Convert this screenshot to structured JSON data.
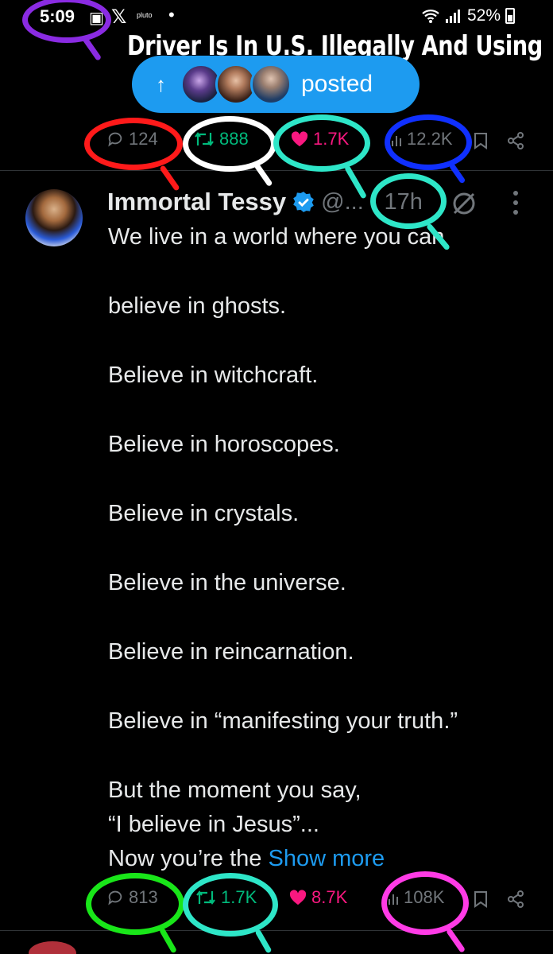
{
  "status_bar": {
    "time": "5:09",
    "battery": "52%",
    "icons": [
      "notification-icon",
      "x-logo-icon",
      "pluto-tv-icon",
      "dot-icon",
      "wifi-icon",
      "signal-icon",
      "battery-icon"
    ]
  },
  "previous_post": {
    "headline_fragment": "Driver Is In U.S. Illegally And Using",
    "new_posts_pill": {
      "label": "posted",
      "arrow": "↑"
    },
    "actions": {
      "replies": "124",
      "reposts": "888",
      "likes": "1.7K",
      "views": "12.2K"
    }
  },
  "tweet": {
    "author_name": "Immortal Tessy",
    "handle": "@...",
    "time": "· 17h",
    "lines": [
      "We live in a world where you can",
      "believe in ghosts.",
      "Believe in witchcraft.",
      "Believe in horoscopes.",
      "Believe in crystals.",
      "Believe in the universe.",
      "Believe in reincarnation.",
      "Believe in “manifesting your truth.”",
      "But the moment you say,",
      "“I believe in Jesus”...",
      "Now you’re the"
    ],
    "show_more": "Show more",
    "actions": {
      "replies": "813",
      "reposts": "1.7K",
      "likes": "8.7K",
      "views": "108K"
    }
  },
  "colors": {
    "background": "#000000",
    "accent_blue": "#1d9bf0",
    "repost_green": "#00ba7c",
    "like_pink": "#f91880",
    "annotation_purple": "#8a2be2",
    "annotation_red": "#ff1a1a",
    "annotation_white": "#ffffff",
    "annotation_cyan": "#2ee6c8",
    "annotation_blue": "#1030ff",
    "annotation_green": "#19e619",
    "annotation_magenta": "#ff3be6"
  }
}
